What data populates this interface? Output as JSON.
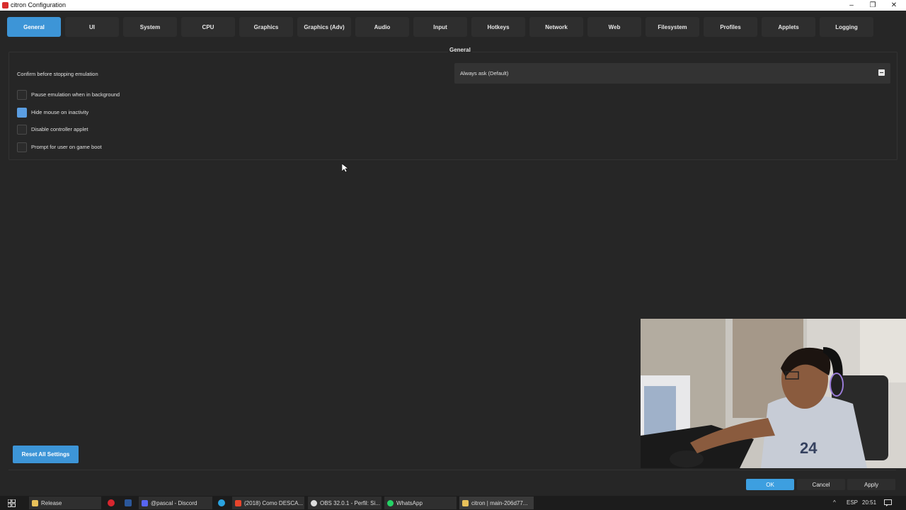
{
  "window": {
    "title": "citron Configuration",
    "controls": [
      "–",
      "❐",
      "✕"
    ]
  },
  "tabs": [
    {
      "label": "General",
      "active": true
    },
    {
      "label": "UI"
    },
    {
      "label": "System"
    },
    {
      "label": "CPU"
    },
    {
      "label": "Graphics"
    },
    {
      "label": "Graphics (Adv)"
    },
    {
      "label": "Audio"
    },
    {
      "label": "Input"
    },
    {
      "label": "Hotkeys"
    },
    {
      "label": "Network"
    },
    {
      "label": "Web"
    },
    {
      "label": "Filesystem"
    },
    {
      "label": "Profiles"
    },
    {
      "label": "Applets"
    },
    {
      "label": "Logging"
    }
  ],
  "general": {
    "group_title": "General",
    "confirm_label": "Confirm before stopping emulation",
    "confirm_value": "Always ask (Default)",
    "checkboxes": [
      {
        "label": "Pause emulation when in background",
        "checked": false
      },
      {
        "label": "Hide mouse on inactivity",
        "checked": true
      },
      {
        "label": "Disable controller applet",
        "checked": false
      },
      {
        "label": "Prompt for user on game boot",
        "checked": false
      }
    ],
    "reset_label": "Reset All Settings"
  },
  "dialog_buttons": {
    "ok": "OK",
    "cancel": "Cancel",
    "apply": "Apply"
  },
  "taskbar": {
    "items": [
      {
        "label": "Release",
        "icon_color": "#e8c15a"
      },
      {
        "label": "@pascal - Discord",
        "icon_color": "#5865f2"
      },
      {
        "label": "(2018) Como DESCA...",
        "icon_color": "#e8452c"
      },
      {
        "label": "OBS 32.0.1 - Perfil: Si...",
        "icon_color": "#dddddd"
      },
      {
        "label": "WhatsApp",
        "icon_color": "#25d366"
      },
      {
        "label": "citron | main-206d77...",
        "icon_color": "#e8c15a"
      }
    ],
    "language": "ESP",
    "time": "20:51"
  },
  "colors": {
    "accent": "#3d95d7",
    "background": "#262626",
    "checked": "#5b9ee2"
  }
}
